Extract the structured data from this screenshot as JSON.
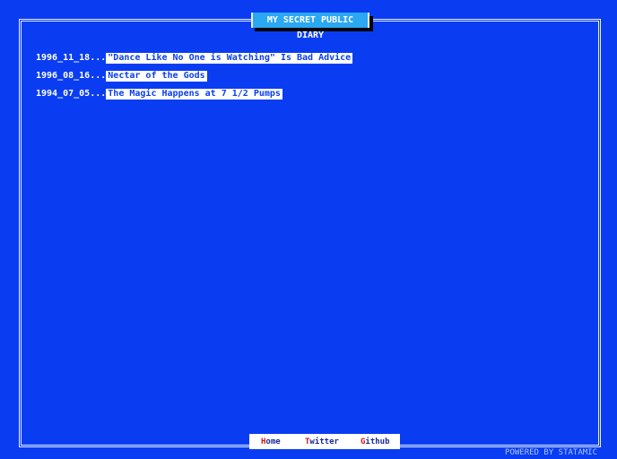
{
  "header": {
    "title": "MY SECRET PUBLIC DIARY"
  },
  "entries": [
    {
      "date": "1996_11_18...",
      "title": "\"Dance Like No One is Watching\" Is Bad Advice"
    },
    {
      "date": "1996_08_16...",
      "title": "Nectar of the Gods"
    },
    {
      "date": "1994_07_05...",
      "title": "The Magic Happens at 7 1/2 Pumps"
    }
  ],
  "nav": [
    {
      "first": "H",
      "rest": "ome"
    },
    {
      "first": "T",
      "rest": "witter"
    },
    {
      "first": "G",
      "rest": "ithub"
    }
  ],
  "footer": {
    "powered": "POWERED BY STATAMIC"
  },
  "colors": {
    "background": "#0a3df2",
    "title_bg": "#2aa8f2",
    "nav_accent": "#d01818"
  }
}
